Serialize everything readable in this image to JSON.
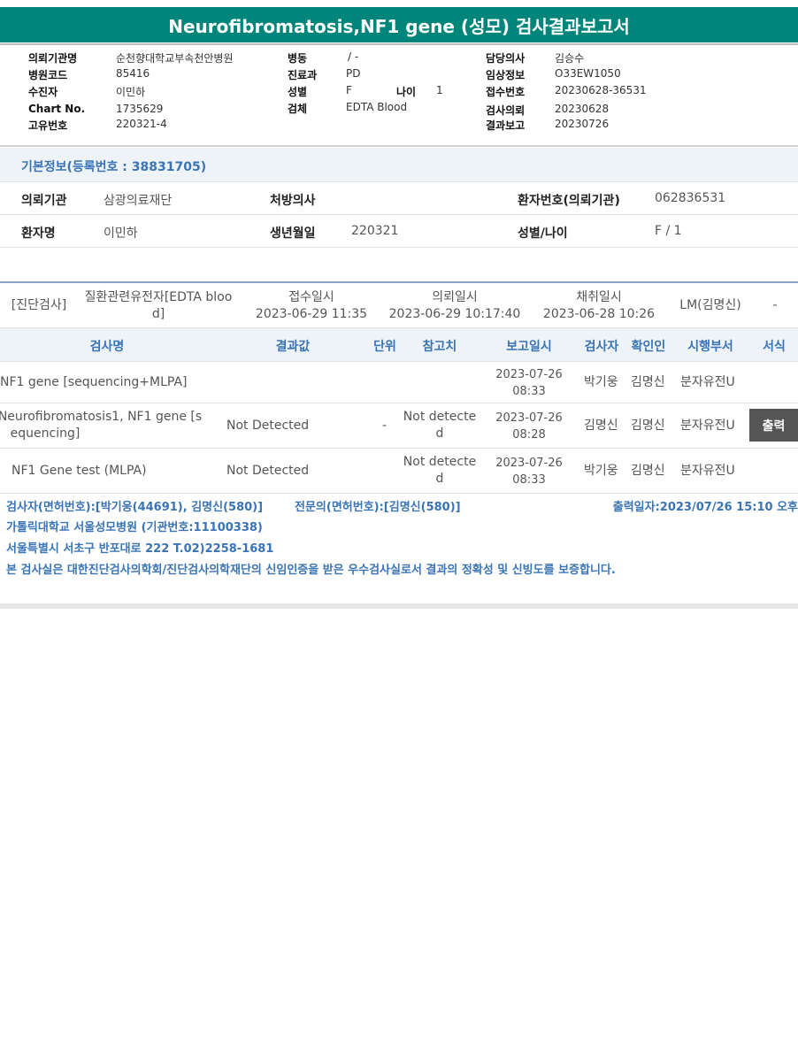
{
  "title": "Neurofibromatosis,NF1 gene (성모) 검사결과보고서",
  "report_header": {
    "col1": [
      {
        "label": "의뢰기관명",
        "value": "순천향대학교부속천안병원"
      },
      {
        "label": "병원코드",
        "value": "85416"
      },
      {
        "label": "수진자",
        "value": "이민하"
      },
      {
        "label": "Chart No.",
        "value": "1735629"
      },
      {
        "label": "고유번호",
        "value": "220321-4"
      }
    ],
    "col2": [
      {
        "label": "병동",
        "value": "/ -"
      },
      {
        "label": "진료과",
        "value": "PD"
      },
      {
        "label": "성별",
        "value": "F"
      },
      {
        "label": "검체",
        "value": "EDTA Blood"
      }
    ],
    "age_label": "나이",
    "age_value": "1",
    "col3": [
      {
        "label": "담당의사",
        "value": "김승수"
      },
      {
        "label": "임상정보",
        "value": "O33EW1050"
      },
      {
        "label": "접수번호",
        "value": "20230628-36531"
      },
      {
        "label": "검사의뢰",
        "value": "20230628"
      },
      {
        "label": "결과보고",
        "value": "20230726"
      }
    ]
  },
  "basic_info": {
    "header": "기본정보(등록번호 : 38831705)",
    "row1": {
      "org_label": "의뢰기관",
      "org_value": "삼광의료재단",
      "doctor_label": "처방의사",
      "doctor_value": "",
      "patno_label": "환자번호(의뢰기관)",
      "patno_value": "062836531"
    },
    "row2": {
      "name_label": "환자명",
      "name_value": "이민하",
      "dob_label": "생년월일",
      "dob_value": "220321",
      "sex_label": "성별/나이",
      "sex_value": "F / 1"
    }
  },
  "order": {
    "category": "[진단검사]",
    "specimen_line1": "질환관련유전자[EDTA bloo",
    "specimen_line2": "d]",
    "received_label": "접수일시",
    "received_value": "2023-06-29 11:35",
    "requested_label": "의뢰일시",
    "requested_value": "2023-06-29 10:17:40",
    "collected_label": "채취일시",
    "collected_value": "2023-06-28 10:26",
    "lab": "LM(김명신)",
    "extra": "-"
  },
  "table": {
    "headers": [
      "검사명",
      "결과값",
      "단위",
      "참고치",
      "보고일시",
      "검사자",
      "확인인",
      "시행부서",
      "서식"
    ],
    "rows": [
      {
        "name1": "NF1 gene [sequencing+MLPA]",
        "name2": "",
        "result": "",
        "unit": "",
        "ref1": "",
        "ref2": "",
        "date": "2023-07-26",
        "time": "08:33",
        "tester": "박기웅",
        "checker": "김명신",
        "dept": "분자유전U",
        "form": ""
      },
      {
        "name1": "Neurofibromatosis1, NF1 gene [s",
        "name2": "equencing]",
        "result": "Not Detected",
        "unit": "-",
        "ref1": "Not detecte",
        "ref2": "d",
        "date": "2023-07-26",
        "time": "08:28",
        "tester": "김명신",
        "checker": "김명신",
        "dept": "분자유전U",
        "form": "출력"
      },
      {
        "name1": "NF1 Gene test (MLPA)",
        "name2": "",
        "result": "Not Detected",
        "unit": "",
        "ref1": "Not detecte",
        "ref2": "d",
        "date": "2023-07-26",
        "time": "08:33",
        "tester": "박기웅",
        "checker": "김명신",
        "dept": "분자유전U",
        "form": ""
      }
    ]
  },
  "footer": {
    "testers": "검사자(면허번호):[박기웅(44691), 김명신(580)]",
    "specialist": "전문의(면허번호):[김명신(580)]",
    "printed": "출력일자:2023/07/26 15:10 오후",
    "hospital": "가톨릭대학교 서울성모병원 (기관번호:11100338)",
    "address": "서울특별시 서초구 반포대로 222 T.02)2258-1681",
    "certification": "본 검사실은 대한진단검사의학회/진단검사의학재단의 신임인증을 받은 우수검사실로서 결과의 정확성 및 신빙도를 보증합니다."
  }
}
